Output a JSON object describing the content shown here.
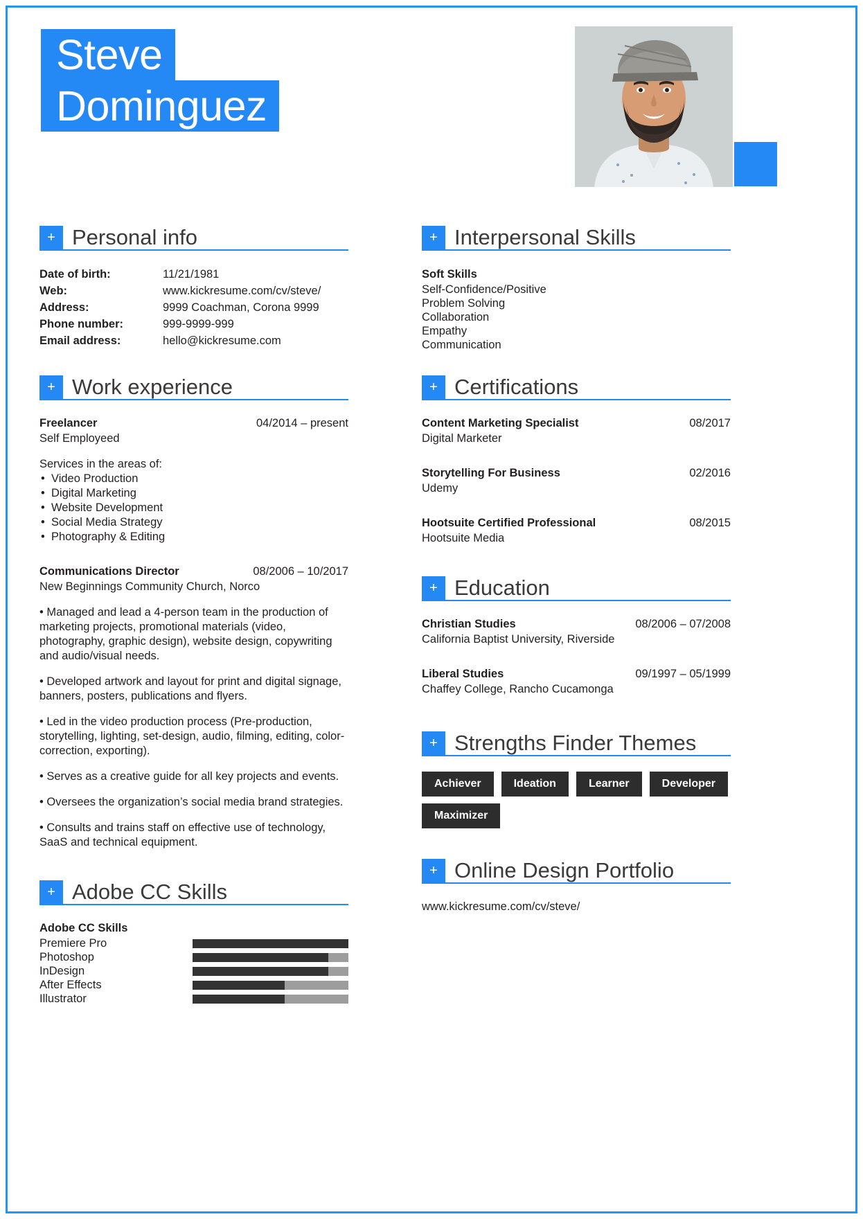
{
  "theme": {
    "accent": "#2589f5",
    "tag_bg": "#2d2d2d",
    "bar_fill": "#333333",
    "bar_track": "#9d9d9d",
    "text": "#231f20"
  },
  "header": {
    "first_name": "Steve",
    "last_name": "Dominguez",
    "photo_alt": "portrait-photo"
  },
  "section_icon": "+",
  "left": {
    "personal_info": {
      "title": "Personal info",
      "rows": [
        {
          "label": "Date of birth:",
          "value": "11/21/1981"
        },
        {
          "label": "Web:",
          "value": "www.kickresume.com/cv/steve/"
        },
        {
          "label": "Address:",
          "value": "9999 Coachman, Corona 9999"
        },
        {
          "label": "Phone number:",
          "value": "999-9999-999"
        },
        {
          "label": "Email address:",
          "value": "hello@kickresume.com"
        }
      ]
    },
    "work_experience": {
      "title": "Work experience",
      "jobs": [
        {
          "role": "Freelancer",
          "date": "04/2014 – present",
          "company": "Self Employeed",
          "intro": "Services in the areas of:",
          "bullets": [
            "Video Production",
            "Digital Marketing",
            "Website Development",
            "Social Media Strategy",
            "Photography & Editing"
          ],
          "paragraphs": []
        },
        {
          "role": "Communications Director",
          "date": "08/2006 – 10/2017",
          "company": "New Beginnings Community Church, Norco",
          "intro": "",
          "bullets": [],
          "paragraphs": [
            "• Managed and lead a 4-person team in the production of marketing projects, promotional materials (video, photography, graphic design), website design, copywriting and audio/visual needs.",
            "• Developed artwork and layout for print and digital signage, banners, posters, publications and flyers.",
            "• Led in the video production process (Pre-production, storytelling, lighting, set-design, audio, filming, editing, color-correction, exporting).",
            "• Serves as a creative guide for all key projects and events.",
            "• Oversees the organization’s social media brand strategies.",
            "• Consults and trains staff on effective use of technology, SaaS and technical equipment."
          ]
        }
      ]
    },
    "adobe_skills": {
      "title": "Adobe CC Skills",
      "group_label": "Adobe CC Skills",
      "skills": [
        {
          "name": "Premiere Pro",
          "level": 100
        },
        {
          "name": "Photoshop",
          "level": 87
        },
        {
          "name": "InDesign",
          "level": 87
        },
        {
          "name": "After Effects",
          "level": 59
        },
        {
          "name": "Illustrator",
          "level": 59
        }
      ]
    }
  },
  "right": {
    "interpersonal": {
      "title": "Interpersonal Skills",
      "group_label": "Soft Skills",
      "items": [
        "Self-Confidence/Positive",
        "Problem Solving",
        "Collaboration",
        "Empathy",
        "Communication"
      ]
    },
    "certifications": {
      "title": "Certifications",
      "items": [
        {
          "name": "Content Marketing Specialist",
          "date": "08/2017",
          "issuer": "Digital Marketer"
        },
        {
          "name": "Storytelling For Business",
          "date": "02/2016",
          "issuer": "Udemy"
        },
        {
          "name": "Hootsuite Certified Professional",
          "date": "08/2015",
          "issuer": "Hootsuite Media"
        }
      ]
    },
    "education": {
      "title": "Education",
      "items": [
        {
          "program": "Christian Studies",
          "date": "08/2006 – 07/2008",
          "school": "California Baptist University, Riverside"
        },
        {
          "program": "Liberal Studies",
          "date": "09/1997 – 05/1999",
          "school": "Chaffey College, Rancho Cucamonga"
        }
      ]
    },
    "strengths": {
      "title": "Strengths Finder Themes",
      "tags": [
        "Achiever",
        "Ideation",
        "Learner",
        "Developer",
        "Maximizer"
      ]
    },
    "portfolio": {
      "title": "Online Design Portfolio",
      "link": "www.kickresume.com/cv/steve/"
    }
  }
}
